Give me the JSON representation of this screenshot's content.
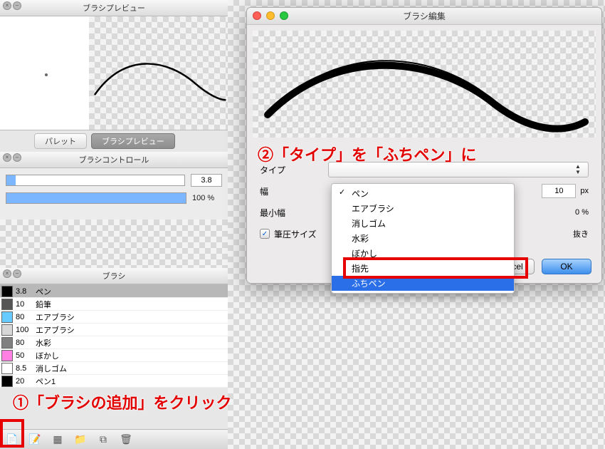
{
  "left": {
    "preview_title": "ブラシプレビュー",
    "tabs": {
      "palette": "パレット",
      "preview": "ブラシプレビュー"
    },
    "control_title": "ブラシコントロール",
    "size_value": "3.8",
    "opacity_value": "100 %",
    "brush_panel_title": "ブラシ",
    "brushes": [
      {
        "sel": true,
        "color": "#000000",
        "size": "3.8",
        "name": "ペン"
      },
      {
        "sel": false,
        "color": "#555555",
        "size": "10",
        "name": "鉛筆"
      },
      {
        "sel": false,
        "color": "#66ccff",
        "size": "80",
        "name": "エアブラシ"
      },
      {
        "sel": false,
        "color": "#d7d7d7",
        "size": "100",
        "name": "エアブラシ"
      },
      {
        "sel": false,
        "color": "#808080",
        "size": "80",
        "name": "水彩"
      },
      {
        "sel": false,
        "color": "#ff7fe3",
        "size": "50",
        "name": "ぼかし"
      },
      {
        "sel": false,
        "color": "#ffffff",
        "size": "8.5",
        "name": "消しゴム"
      },
      {
        "sel": false,
        "color": "#000000",
        "size": "20",
        "name": "ペン1"
      }
    ]
  },
  "dialog": {
    "title": "ブラシ編集",
    "labels": {
      "type": "タイプ",
      "width": "幅",
      "minwidth": "最小幅",
      "pressure": "筆圧サイズ"
    },
    "width_value": "10",
    "width_unit": "px",
    "minwidth_value": "0 %",
    "trailing_label": "抜き",
    "dropdown": {
      "items": [
        "ペン",
        "エアブラシ",
        "消しゴム",
        "水彩",
        "ぼかし",
        "指先",
        "ふちペン"
      ],
      "checked_index": 0,
      "highlight_index": 6
    },
    "buttons": {
      "cancel": "Cancel",
      "ok": "OK"
    }
  },
  "callouts": {
    "c1": "①「ブラシの追加」をクリック",
    "c2": "②「タイプ」を「ふちペン」に"
  }
}
